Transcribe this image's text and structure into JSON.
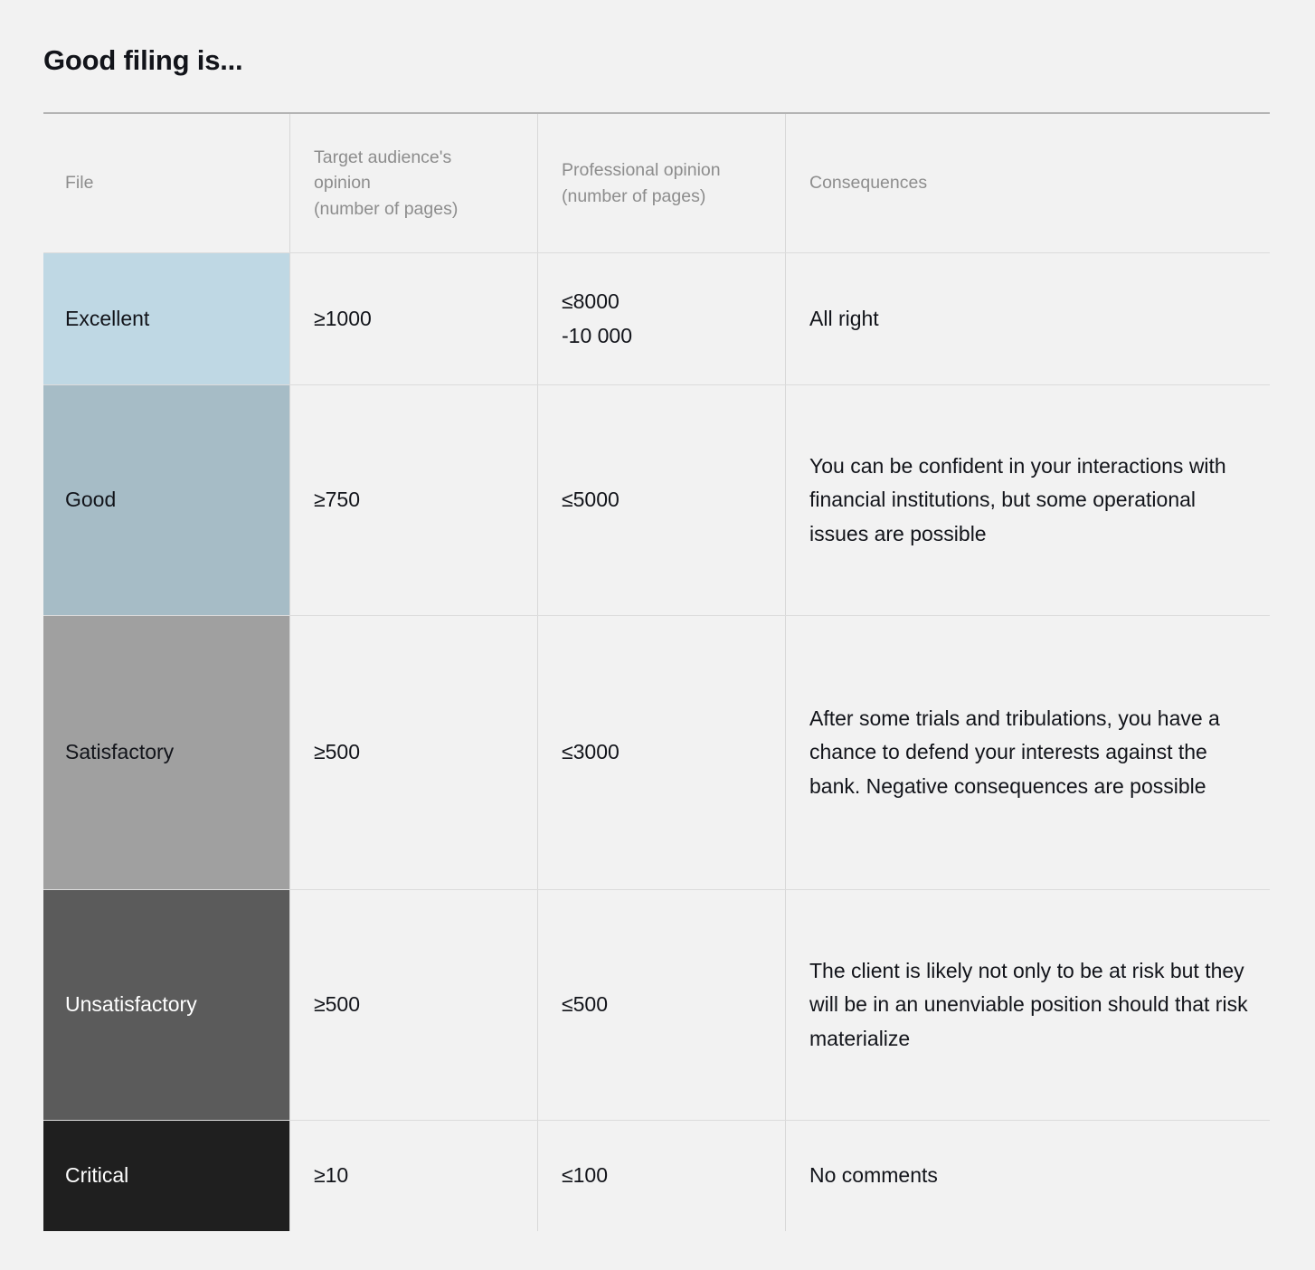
{
  "title": "Good filing is...",
  "colors": {
    "page_background": "#f2f2f2",
    "rule": "#b4b4b4",
    "grid_line": "#dcdcdc",
    "header_text": "#8d8d8d",
    "body_text": "#12141a",
    "excellent": "#bfd8e4",
    "good": "#a6bcc6",
    "satisfactory": "#a0a0a0",
    "unsatisfactory": "#5b5b5b",
    "critical": "#1f1f1f"
  },
  "table": {
    "headers": {
      "file": "File",
      "target": "Target audience's\nopinion\n(number of pages)",
      "professional": "Professional opinion\n(number of pages)",
      "consequences": "Consequences"
    },
    "rows": [
      {
        "file": "Excellent",
        "target": "≥1000",
        "professional": "≤8000\n-10 000",
        "consequences": "All right",
        "swatch_color": "#bfd8e4",
        "swatch_text_color": "#12141a"
      },
      {
        "file": "Good",
        "target": "≥750",
        "professional": "≤5000",
        "consequences": "You can be confident in your interactions with financial institutions, but some operational issues are possible",
        "swatch_color": "#a6bcc6",
        "swatch_text_color": "#12141a"
      },
      {
        "file": "Satisfactory",
        "target": "≥500",
        "professional": "≤3000",
        "consequences": "After some trials and tribulations, you have a chance to defend your interests against the bank. Negative consequences are possible",
        "swatch_color": "#a0a0a0",
        "swatch_text_color": "#12141a"
      },
      {
        "file": "Unsatisfactory",
        "target": "≥500",
        "professional": "≤500",
        "consequences": "The client is likely not only to be at risk but they will be in an unenviable position should that risk materialize",
        "swatch_color": "#5b5b5b",
        "swatch_text_color": "#ffffff"
      },
      {
        "file": "Critical",
        "target": "≥10",
        "professional": "≤100",
        "consequences": "No comments",
        "swatch_color": "#1f1f1f",
        "swatch_text_color": "#ffffff"
      }
    ]
  }
}
